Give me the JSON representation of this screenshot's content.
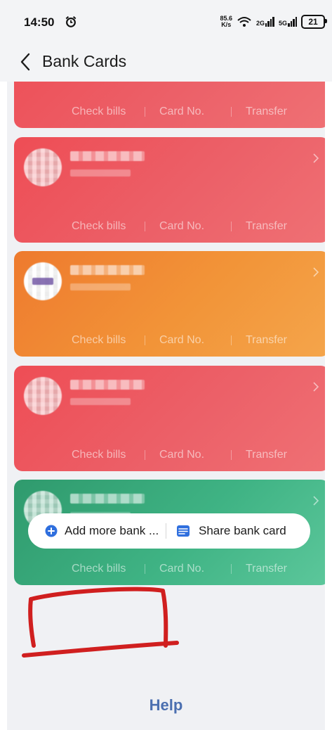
{
  "status_bar": {
    "time": "14:50",
    "speed_value": "85.6",
    "speed_unit": "K/s",
    "sim1_network": "2G",
    "sim2_network": "5G",
    "battery": "21"
  },
  "header": {
    "title": "Bank Cards"
  },
  "card_actions": {
    "check_bills": "Check bills",
    "card_no": "Card No.",
    "transfer": "Transfer"
  },
  "cards": [
    {
      "color": "red",
      "hex": "#ee4d55"
    },
    {
      "color": "red",
      "hex": "#ee4d55"
    },
    {
      "color": "orange",
      "hex": "#f29438"
    },
    {
      "color": "red",
      "hex": "#ee4d55"
    },
    {
      "color": "green",
      "hex": "#3fb384"
    }
  ],
  "buttons": {
    "add_more_bank": "Add more bank ...",
    "share_bank_card": "Share bank card"
  },
  "footer": {
    "help": "Help"
  },
  "colors": {
    "accent_blue": "#2f6fde",
    "help_link": "#4b6fb0",
    "annotation_red": "#d01f1f"
  }
}
